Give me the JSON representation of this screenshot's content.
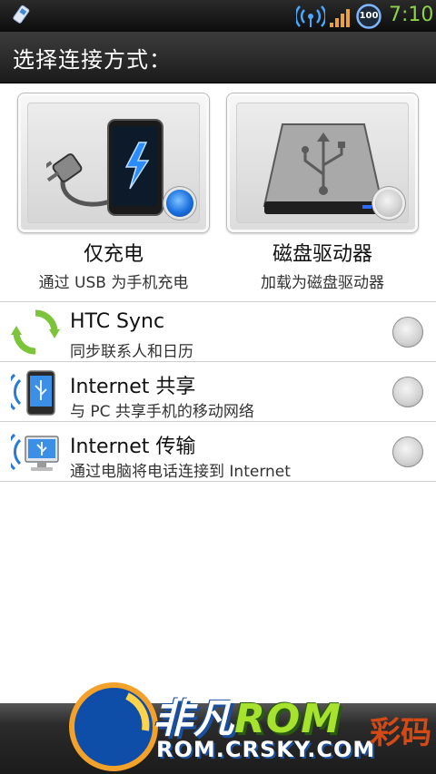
{
  "status_bar": {
    "clock": "7:10",
    "battery_level": "100",
    "icons": [
      "usb-debug-icon",
      "wifi-hotspot-icon",
      "signal-strength-icon",
      "battery-icon"
    ]
  },
  "header": {
    "title": "选择连接方式："
  },
  "options": [
    {
      "title": "仅充电",
      "subtitle": "通过 USB 为手机充电",
      "icon": "charge-phone-icon",
      "selected": true
    },
    {
      "title": "磁盘驱动器",
      "subtitle": "加载为磁盘驱动器",
      "icon": "disk-drive-icon",
      "selected": false
    }
  ],
  "list": [
    {
      "title": "HTC Sync",
      "subtitle": "同步联系人和日历",
      "icon": "sync-icon",
      "selected": false
    },
    {
      "title": "Internet 共享",
      "subtitle": "与 PC 共享手机的移动网络",
      "icon": "internet-share-icon",
      "selected": false
    },
    {
      "title": "Internet 传输",
      "subtitle": "通过电脑将电话连接到 Internet",
      "icon": "internet-pass-through-icon",
      "selected": false
    }
  ],
  "watermark": {
    "brand_prefix": "非凡",
    "brand_suffix": "ROM",
    "url": "ROM.CRSKY.COM",
    "corner": "彩码"
  },
  "colors": {
    "accent_green": "#8fd24a",
    "radio_selected": "#1a6fe0",
    "title_bar": "#2a2a2a"
  }
}
